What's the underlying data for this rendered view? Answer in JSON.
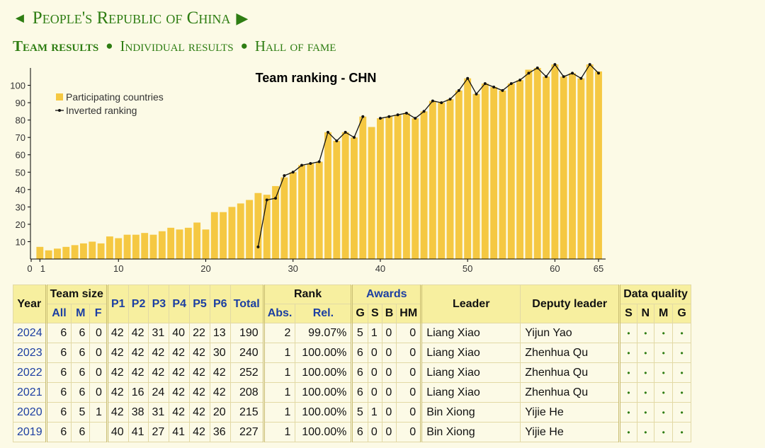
{
  "header": {
    "prev_arrow": "◄",
    "country": "People's Republic of China",
    "next_arrow": "▶"
  },
  "subnav": {
    "team": "Team results",
    "individual": "Individual results",
    "hall": "Hall of fame",
    "separator": "●"
  },
  "chart_data": {
    "type": "bar",
    "title": "Team ranking - CHN",
    "legend": [
      "Participating countries",
      "Inverted ranking"
    ],
    "legend_position": "top-left",
    "x_ticks": [
      "0",
      "1",
      "10",
      "20",
      "30",
      "40",
      "50",
      "60",
      "65"
    ],
    "y_ticks": [
      10,
      20,
      30,
      40,
      50,
      60,
      70,
      80,
      90,
      100
    ],
    "xlim": [
      0,
      65
    ],
    "ylim": [
      0,
      110
    ],
    "grid": false,
    "x": [
      1,
      2,
      3,
      4,
      5,
      6,
      7,
      8,
      9,
      10,
      11,
      12,
      13,
      14,
      15,
      16,
      17,
      18,
      19,
      20,
      21,
      22,
      23,
      24,
      25,
      26,
      27,
      28,
      29,
      30,
      31,
      32,
      33,
      34,
      35,
      36,
      37,
      38,
      39,
      40,
      41,
      42,
      43,
      44,
      45,
      46,
      47,
      48,
      49,
      50,
      51,
      52,
      53,
      54,
      55,
      56,
      57,
      58,
      59,
      60,
      61,
      62,
      63,
      64,
      65
    ],
    "series": [
      {
        "name": "Participating countries",
        "values": [
          7,
          5,
          6,
          7,
          8,
          9,
          10,
          9,
          13,
          12,
          14,
          14,
          15,
          14,
          16,
          18,
          17,
          18,
          21,
          17,
          27,
          27,
          30,
          32,
          34,
          38,
          37,
          42,
          47,
          50,
          54,
          55,
          56,
          73,
          68,
          73,
          70,
          82,
          76,
          81,
          82,
          83,
          84,
          81,
          85,
          91,
          90,
          92,
          97,
          104,
          95,
          101,
          99,
          97,
          101,
          103,
          109,
          110,
          105,
          112,
          105,
          107,
          104,
          112,
          108
        ],
        "color": "#f5c842"
      },
      {
        "name": "Inverted ranking",
        "x": [
          26,
          27,
          28,
          29,
          30,
          31,
          32,
          33,
          34,
          35,
          36,
          37,
          38,
          40,
          41,
          42,
          43,
          44,
          45,
          46,
          47,
          48,
          49,
          50,
          51,
          52,
          53,
          54,
          55,
          56,
          57,
          58,
          59,
          60,
          61,
          62,
          63,
          64,
          65
        ],
        "values": [
          7,
          34,
          35,
          48,
          50,
          54,
          55,
          56,
          73,
          68,
          73,
          70,
          82,
          81,
          82,
          83,
          84,
          81,
          85,
          91,
          90,
          92,
          97,
          104,
          95,
          101,
          99,
          97,
          101,
          103,
          107,
          110,
          105,
          112,
          105,
          107,
          104,
          112,
          107
        ],
        "color": "#111111"
      }
    ]
  },
  "table": {
    "headers": {
      "year": "Year",
      "team_size": "Team size",
      "all": "All",
      "m": "M",
      "f": "F",
      "problems": [
        "P1",
        "P2",
        "P3",
        "P4",
        "P5",
        "P6"
      ],
      "total": "Total",
      "rank": "Rank",
      "abs": "Abs.",
      "rel": "Rel.",
      "awards": "Awards",
      "award_cols": [
        "G",
        "S",
        "B",
        "HM"
      ],
      "leader": "Leader",
      "deputy": "Deputy leader",
      "data_quality": "Data quality",
      "dq_cols": [
        "S",
        "N",
        "M",
        "G"
      ]
    },
    "rows": [
      {
        "year": "2024",
        "all": "6",
        "m": "6",
        "f": "0",
        "p": [
          "42",
          "42",
          "31",
          "40",
          "22",
          "13"
        ],
        "total": "190",
        "abs": "2",
        "rel": "99.07%",
        "g": "5",
        "s": "1",
        "b": "0",
        "hm": "0",
        "leader": "Liang Xiao",
        "deputy": "Yijun Yao",
        "dq": [
          "•",
          "•",
          "•",
          "•"
        ]
      },
      {
        "year": "2023",
        "all": "6",
        "m": "6",
        "f": "0",
        "p": [
          "42",
          "42",
          "42",
          "42",
          "42",
          "30"
        ],
        "total": "240",
        "abs": "1",
        "rel": "100.00%",
        "g": "6",
        "s": "0",
        "b": "0",
        "hm": "0",
        "leader": "Liang Xiao",
        "deputy": "Zhenhua Qu",
        "dq": [
          "•",
          "•",
          "•",
          "•"
        ]
      },
      {
        "year": "2022",
        "all": "6",
        "m": "6",
        "f": "0",
        "p": [
          "42",
          "42",
          "42",
          "42",
          "42",
          "42"
        ],
        "total": "252",
        "abs": "1",
        "rel": "100.00%",
        "g": "6",
        "s": "0",
        "b": "0",
        "hm": "0",
        "leader": "Liang Xiao",
        "deputy": "Zhenhua Qu",
        "dq": [
          "•",
          "•",
          "•",
          "•"
        ]
      },
      {
        "year": "2021",
        "all": "6",
        "m": "6",
        "f": "0",
        "p": [
          "42",
          "16",
          "24",
          "42",
          "42",
          "42"
        ],
        "total": "208",
        "abs": "1",
        "rel": "100.00%",
        "g": "6",
        "s": "0",
        "b": "0",
        "hm": "0",
        "leader": "Liang Xiao",
        "deputy": "Zhenhua Qu",
        "dq": [
          "•",
          "•",
          "•",
          "•"
        ]
      },
      {
        "year": "2020",
        "all": "6",
        "m": "5",
        "f": "1",
        "p": [
          "42",
          "38",
          "31",
          "42",
          "42",
          "20"
        ],
        "total": "215",
        "abs": "1",
        "rel": "100.00%",
        "g": "5",
        "s": "1",
        "b": "0",
        "hm": "0",
        "leader": "Bin Xiong",
        "deputy": "Yijie He",
        "dq": [
          "•",
          "•",
          "•",
          "•"
        ]
      },
      {
        "year": "2019",
        "all": "6",
        "m": "6",
        "f": "",
        "p": [
          "40",
          "41",
          "27",
          "41",
          "42",
          "36"
        ],
        "total": "227",
        "abs": "1",
        "rel": "100.00%",
        "g": "6",
        "s": "0",
        "b": "0",
        "hm": "0",
        "leader": "Bin Xiong",
        "deputy": "Yijie He",
        "dq": [
          "•",
          "•",
          "•",
          "•"
        ]
      }
    ]
  }
}
